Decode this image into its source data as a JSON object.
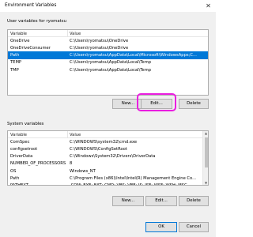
{
  "window": {
    "title": "Environment Variables",
    "close_glyph": "✕"
  },
  "user_group": {
    "label": "User variables for ryomatsu",
    "columns": [
      "Variable",
      "Value"
    ],
    "rows": [
      {
        "variable": "OneDrive",
        "value": "C:\\Users\\ryomatsu\\OneDrive"
      },
      {
        "variable": "OneDriveConsumer",
        "value": "C:\\Users\\ryomatsu\\OneDrive"
      },
      {
        "variable": "Path",
        "value": "C:\\Users\\ryomatsu\\AppData\\Local\\Microsoft\\WindowsApps;C...",
        "selected": true
      },
      {
        "variable": "TEMP",
        "value": "C:\\Users\\ryomatsu\\AppData\\Local\\Temp"
      },
      {
        "variable": "TMP",
        "value": "C:\\Users\\ryomatsu\\AppData\\Local\\Temp"
      }
    ],
    "buttons": {
      "new": "New...",
      "edit": "Edit...",
      "delete": "Delete"
    }
  },
  "system_group": {
    "label": "System variables",
    "columns": [
      "Variable",
      "Value"
    ],
    "rows": [
      {
        "variable": "ComSpec",
        "value": "C:\\WINDOWS\\system32\\cmd.exe"
      },
      {
        "variable": "configsetroot",
        "value": "C:\\WINDOWS\\ConfigSetRoot"
      },
      {
        "variable": "DriverData",
        "value": "C:\\Windows\\System32\\Drivers\\DriverData"
      },
      {
        "variable": "NUMBER_OF_PROCESSORS",
        "value": "8"
      },
      {
        "variable": "OS",
        "value": "Windows_NT"
      },
      {
        "variable": "Path",
        "value": "C:\\Program Files (x86)\\Intel\\Intel(R) Management Engine Co..."
      },
      {
        "variable": "PATHEXT",
        "value": ".COM;.EXE;.BAT;.CMD;.VBS;.VBE;.JS;.JSE;.WSF;.WSH;.MSC"
      },
      {
        "variable": "PROCESSOR_ARCHITECTURE",
        "value": "AMD64"
      }
    ],
    "buttons": {
      "new": "New...",
      "edit": "Edit...",
      "delete": "Delete"
    }
  },
  "footer": {
    "ok": "OK",
    "cancel": "Cancel"
  },
  "colors": {
    "selection": "#0078d7",
    "highlight": "#ea1ee0"
  }
}
